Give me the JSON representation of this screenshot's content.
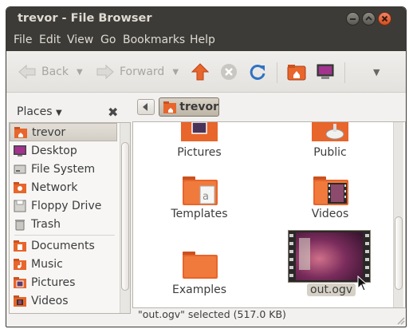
{
  "window": {
    "title": "trevor - File Browser"
  },
  "menu": [
    "File",
    "Edit",
    "View",
    "Go",
    "Bookmarks",
    "Help"
  ],
  "toolbar": {
    "back_label": "Back",
    "forward_label": "Forward"
  },
  "sidebar": {
    "header": "Places",
    "items": [
      {
        "label": "trevor",
        "icon": "home-folder-icon",
        "selected": true
      },
      {
        "label": "Desktop",
        "icon": "desktop-icon"
      },
      {
        "label": "File System",
        "icon": "drive-icon"
      },
      {
        "label": "Network",
        "icon": "network-icon"
      },
      {
        "label": "Floppy Drive",
        "icon": "floppy-icon"
      },
      {
        "label": "Trash",
        "icon": "trash-icon"
      },
      {
        "label": "Documents",
        "icon": "folder-icon"
      },
      {
        "label": "Music",
        "icon": "folder-icon"
      },
      {
        "label": "Pictures",
        "icon": "folder-icon"
      },
      {
        "label": "Videos",
        "icon": "folder-icon"
      }
    ]
  },
  "path": {
    "current": "trevor"
  },
  "files": [
    {
      "name": "Pictures",
      "icon": "pictures-folder-icon"
    },
    {
      "name": "Public",
      "icon": "public-folder-icon"
    },
    {
      "name": "Templates",
      "icon": "templates-folder-icon"
    },
    {
      "name": "Videos",
      "icon": "videos-folder-icon"
    },
    {
      "name": "Examples",
      "icon": "folder-icon"
    },
    {
      "name": "out.ogv",
      "icon": "video-thumbnail",
      "selected": true
    }
  ],
  "status": "\"out.ogv\" selected (517.0 KB)",
  "colors": {
    "accent": "#e8652b",
    "titlebar": "#3c3b37",
    "selection": "#d6d1c6"
  }
}
